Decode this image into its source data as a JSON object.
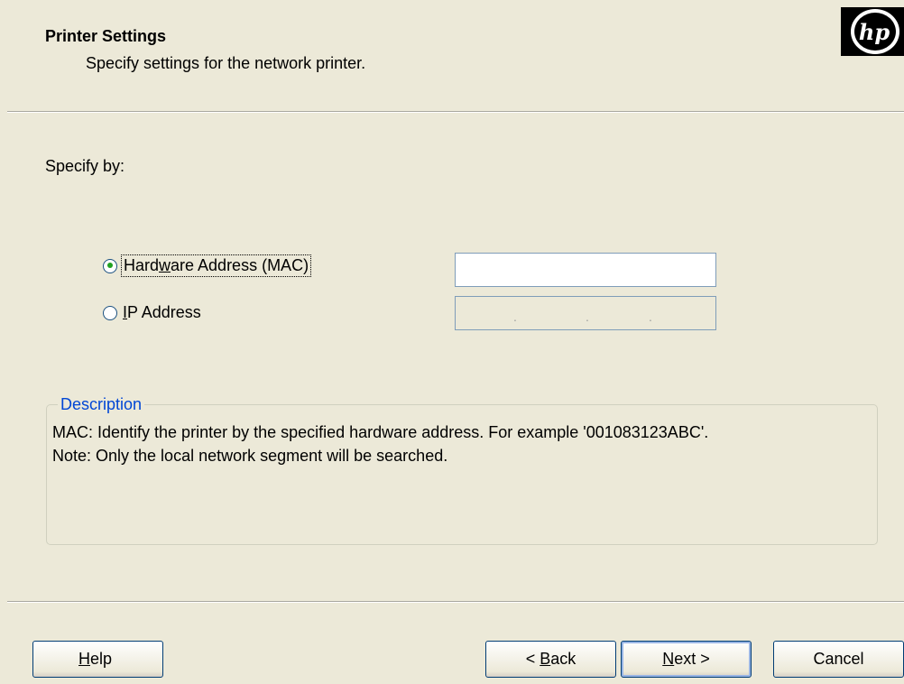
{
  "header": {
    "title": "Printer Settings",
    "subtitle": "Specify settings for the network printer.",
    "logo_text": "hp"
  },
  "form": {
    "specify_label": "Specify by:",
    "options": [
      {
        "label_before": "Hard",
        "label_ul": "w",
        "label_after": "are Address (MAC)",
        "selected": true
      },
      {
        "label_before": "",
        "label_ul": "I",
        "label_after": "P Address",
        "selected": false
      }
    ],
    "mac_value": "",
    "ip_separators": [
      ".",
      ".",
      "."
    ]
  },
  "description": {
    "legend": "Description",
    "line1": "MAC: Identify the printer by the specified hardware address.  For example '001083123ABC'.",
    "line2": "Note: Only the local network segment will be searched."
  },
  "buttons": {
    "help": {
      "ul": "H",
      "rest": "elp"
    },
    "back": {
      "prefix": "< ",
      "ul": "B",
      "rest": "ack"
    },
    "next": {
      "ul": "N",
      "rest": "ext >"
    },
    "cancel": "Cancel"
  },
  "colors": {
    "background": "#ece9d8",
    "legend": "#0046d5",
    "radio_selected": "#21a121"
  }
}
